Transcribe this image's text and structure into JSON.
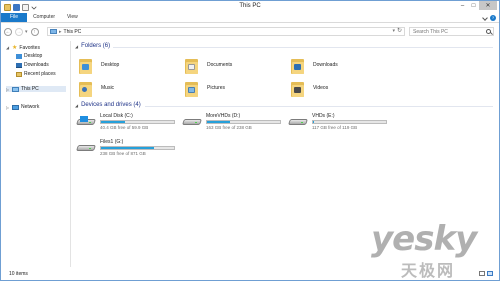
{
  "window": {
    "title": "This PC"
  },
  "ribbon": {
    "tabs": [
      "File",
      "Computer",
      "View"
    ]
  },
  "address": {
    "path": "This PC",
    "search_placeholder": "Search This PC"
  },
  "nav": {
    "favorites": "Favorites",
    "fav_items": [
      "Desktop",
      "Downloads",
      "Recent places"
    ],
    "this_pc": "This PC",
    "network": "Network"
  },
  "folders": {
    "header": "Folders (6)",
    "items": [
      "Desktop",
      "Documents",
      "Downloads",
      "Music",
      "Pictures",
      "Videos"
    ]
  },
  "drives": {
    "header": "Devices and drives (4)",
    "items": [
      {
        "name": "Local Disk (C:)",
        "free": "40.4 GB free of 59.9 GB",
        "used_fraction": 0.33,
        "icon": "windows-drive"
      },
      {
        "name": "MoreVHDs (D:)",
        "free": "163 GB free of 238 GB",
        "used_fraction": 0.32,
        "icon": "hard-drive"
      },
      {
        "name": "VHDs (E:)",
        "free": "117 GB free of 119 GB",
        "used_fraction": 0.02,
        "icon": "hard-drive"
      },
      {
        "name": "Files1 (G:)",
        "free": "238 GB free of 871 GB",
        "used_fraction": 0.73,
        "icon": "hard-drive"
      }
    ]
  },
  "status": {
    "items": "10 items"
  },
  "watermark": {
    "main": "yesky",
    "sub": "天极网"
  },
  "colors": {
    "accent": "#1979ca",
    "drive_bar": "#26a0da",
    "group_header": "#1e3287"
  }
}
